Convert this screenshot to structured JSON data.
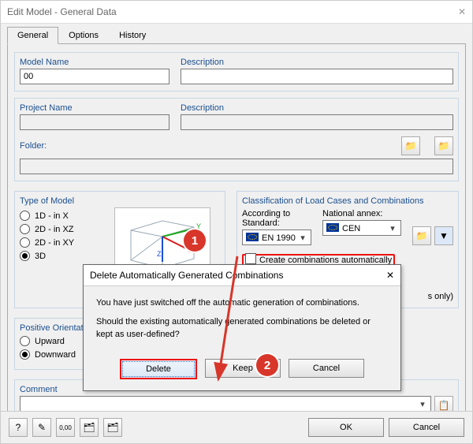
{
  "window": {
    "title": "Edit Model - General Data",
    "close_glyph": "✕"
  },
  "tabs": [
    {
      "label": "General",
      "active": true
    },
    {
      "label": "Options",
      "active": false
    },
    {
      "label": "History",
      "active": false
    }
  ],
  "model": {
    "name_label": "Model Name",
    "name_value": "00",
    "desc_label": "Description",
    "desc_value": ""
  },
  "project": {
    "name_label": "Project Name",
    "name_value": "",
    "desc_label": "Description",
    "desc_value": ""
  },
  "folder": {
    "label": "Folder:",
    "value": ""
  },
  "type_of_model": {
    "legend": "Type of Model",
    "options": [
      {
        "label": "1D - in X",
        "selected": false
      },
      {
        "label": "2D - in XZ",
        "selected": false
      },
      {
        "label": "2D - in XY",
        "selected": false
      },
      {
        "label": "3D",
        "selected": true
      }
    ]
  },
  "classification": {
    "legend": "Classification of Load Cases and Combinations",
    "standard_label": "According to Standard:",
    "standard_value": "EN 1990",
    "annex_label": "National annex:",
    "annex_value": "CEN",
    "auto_combo_label": "Create combinations automatically",
    "auto_combo_checked": false,
    "results_note": "s only)"
  },
  "orientation": {
    "legend": "Positive Orientation",
    "options": [
      {
        "label": "Upward",
        "selected": false
      },
      {
        "label": "Downward",
        "selected": true
      }
    ]
  },
  "comment": {
    "legend": "Comment",
    "value": ""
  },
  "footer": {
    "ok_label": "OK",
    "cancel_label": "Cancel"
  },
  "dialog": {
    "title": "Delete Automatically Generated Combinations",
    "close_glyph": "✕",
    "line1": "You have just switched off the automatic generation of combinations.",
    "line2": "Should the existing automatically generated combinations be deleted or kept as user-defined?",
    "delete_label": "Delete",
    "keep_label": "Keep",
    "cancel_label": "Cancel"
  },
  "markers": {
    "one": "1",
    "two": "2"
  },
  "icons": {
    "folder": "📁",
    "folder2": "📁",
    "wizard": "🧭",
    "filter": "▼",
    "help": "?",
    "edit": "✎",
    "calc": "0,00",
    "pick1": "🗂",
    "pick2": "🗂",
    "dropdown": "▾",
    "copy": "📋"
  }
}
